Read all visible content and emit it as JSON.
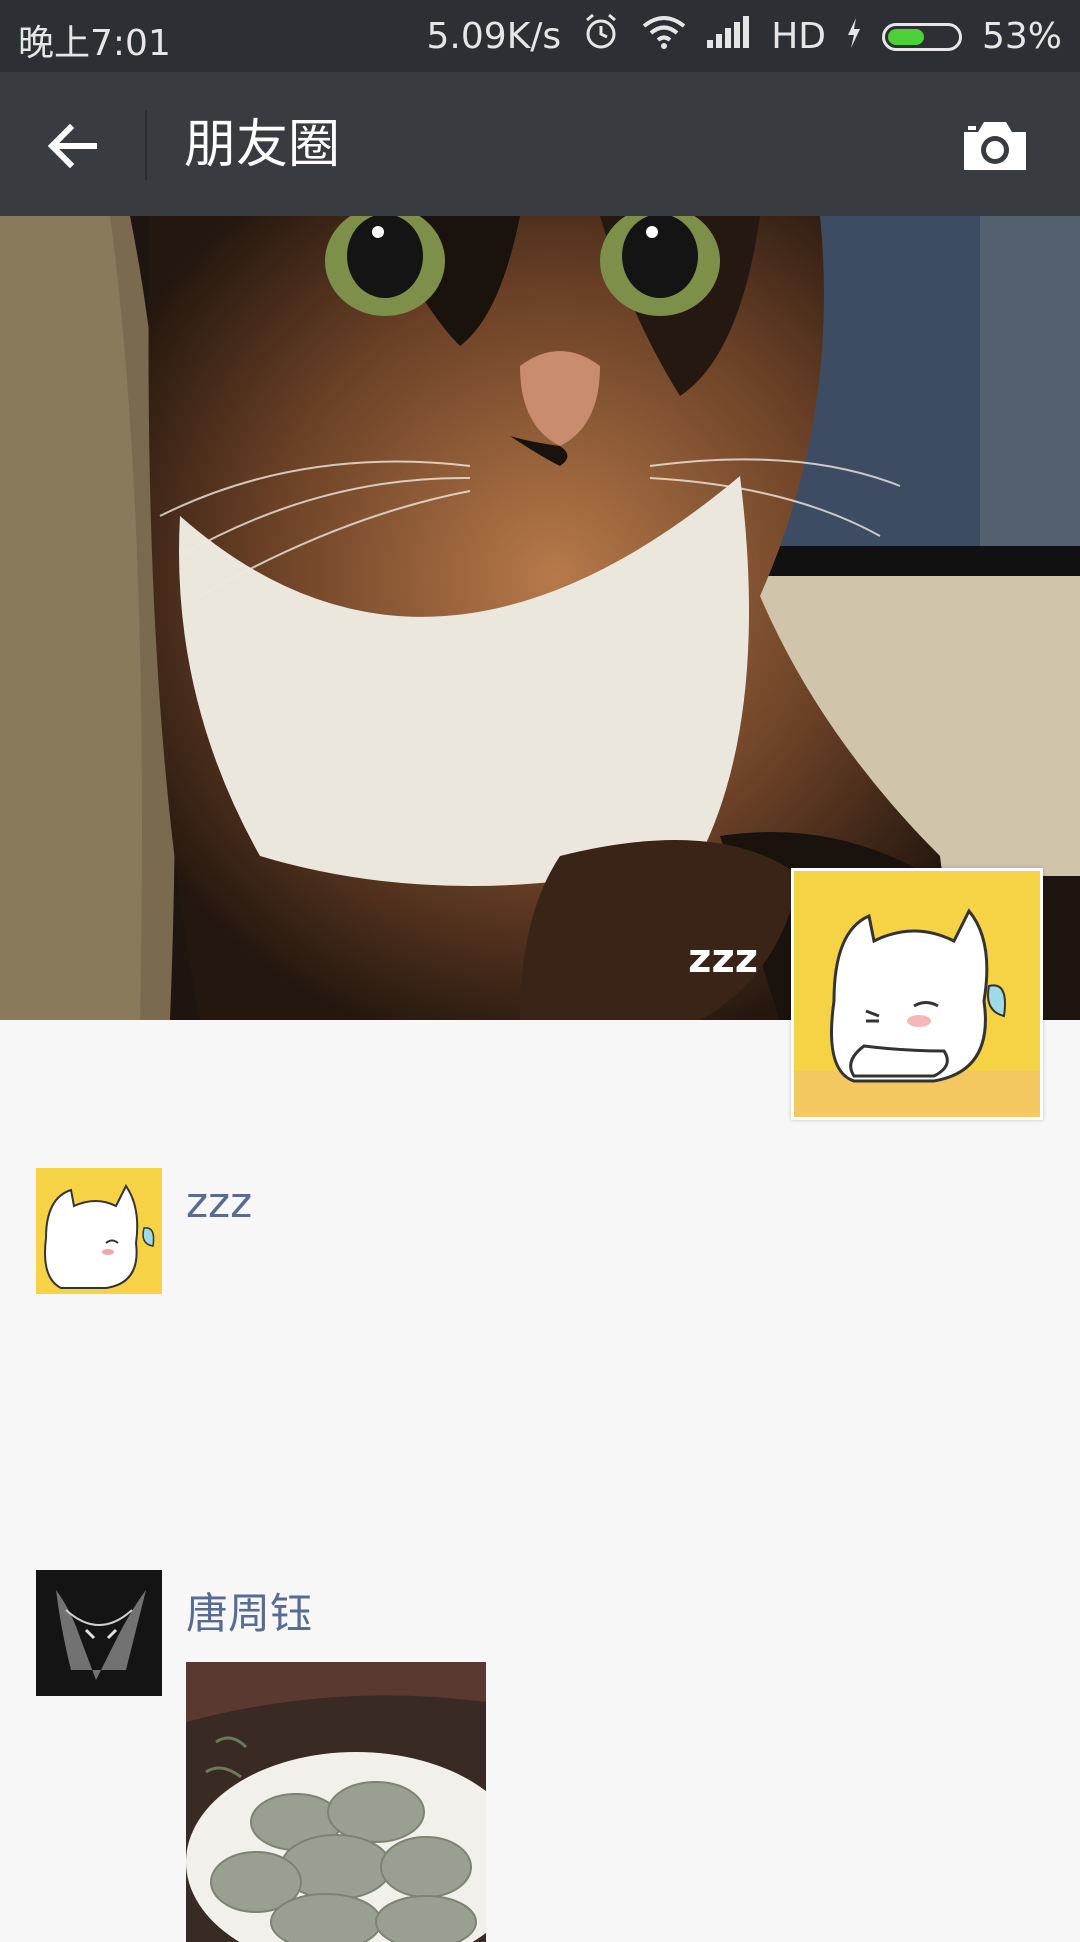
{
  "status_bar": {
    "time": "晚上7:01",
    "speed": "5.09K/s",
    "network": "HD",
    "battery": "53%",
    "battery_level": 0.53
  },
  "header": {
    "title": "朋友圈",
    "back_icon": "arrow-left-icon",
    "camera_icon": "camera-icon"
  },
  "profile": {
    "name": "zzz"
  },
  "feed": [
    {
      "name": "zzz"
    },
    {
      "name": "唐周钰"
    }
  ],
  "colors": {
    "header_bg": "#383b40",
    "status_bg": "#2c2f34",
    "name_link": "#576b95",
    "feed_bg": "#f7f7f7"
  }
}
